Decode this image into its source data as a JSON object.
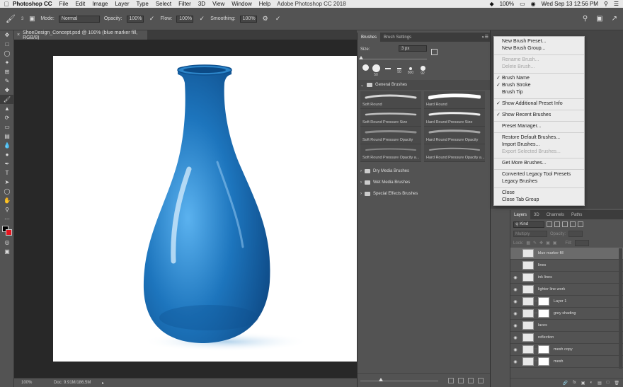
{
  "menubar": {
    "app": "Photoshop CC",
    "items": [
      "File",
      "Edit",
      "Image",
      "Layer",
      "Type",
      "Select",
      "Filter",
      "3D",
      "View",
      "Window",
      "Help"
    ],
    "window_title": "Adobe Photoshop CC 2018",
    "battery": "100%",
    "clock": "Wed Sep 13  12:56 PM"
  },
  "options": {
    "brush_size": "3",
    "mode_label": "Mode:",
    "mode_value": "Normal",
    "opacity_label": "Opacity:",
    "opacity_value": "100%",
    "flow_label": "Flow:",
    "flow_value": "100%",
    "smoothing_label": "Smoothing:",
    "smoothing_value": "100%"
  },
  "document": {
    "tab_title": "ShoeDesign_Concept.psd @ 100% (blue marker fill, RGB/8)",
    "zoom": "100%",
    "doc_size": "Doc: 9.91M/186.5M"
  },
  "brushes": {
    "tabs": [
      "Brushes",
      "Brush Settings"
    ],
    "size_label": "Size:",
    "size_value": "3 px",
    "presets": [
      "50",
      "",
      "50",
      "800",
      "92"
    ],
    "general_group": "General Brushes",
    "cells": [
      "Soft Round",
      "Hard Round",
      "Soft Round Pressure Size",
      "Hard Round Pressure Size",
      "Soft Round Pressure Opacity",
      "Hard Round Pressure Opacity",
      "Soft Round Pressure Opacity a...",
      "Hard Round Pressure Opacity a..."
    ],
    "groups": [
      "Dry Media Brushes",
      "Wet Media Brushes",
      "Special Effects Brushes"
    ]
  },
  "flyout": {
    "sections": [
      [
        {
          "label": "New Brush Preset...",
          "disabled": false,
          "checked": false
        },
        {
          "label": "New Brush Group...",
          "disabled": false,
          "checked": false
        }
      ],
      [
        {
          "label": "Rename Brush...",
          "disabled": true,
          "checked": false
        },
        {
          "label": "Delete Brush...",
          "disabled": true,
          "checked": false
        }
      ],
      [
        {
          "label": "Brush Name",
          "disabled": false,
          "checked": true
        },
        {
          "label": "Brush Stroke",
          "disabled": false,
          "checked": true
        },
        {
          "label": "Brush Tip",
          "disabled": false,
          "checked": false
        }
      ],
      [
        {
          "label": "Show Additional Preset Info",
          "disabled": false,
          "checked": true
        }
      ],
      [
        {
          "label": "Show Recent Brushes",
          "disabled": false,
          "checked": true
        }
      ],
      [
        {
          "label": "Preset Manager...",
          "disabled": false,
          "checked": false
        }
      ],
      [
        {
          "label": "Restore Default Brushes...",
          "disabled": false,
          "checked": false
        },
        {
          "label": "Import Brushes...",
          "disabled": false,
          "checked": false
        },
        {
          "label": "Export Selected Brushes...",
          "disabled": true,
          "checked": false
        }
      ],
      [
        {
          "label": "Get More Brushes...",
          "disabled": false,
          "checked": false
        }
      ],
      [
        {
          "label": "Converted Legacy Tool Presets",
          "disabled": false,
          "checked": false
        },
        {
          "label": "Legacy Brushes",
          "disabled": false,
          "checked": false
        }
      ],
      [
        {
          "label": "Close",
          "disabled": false,
          "checked": false
        },
        {
          "label": "Close Tab Group",
          "disabled": false,
          "checked": false
        }
      ]
    ]
  },
  "layers": {
    "tabs": [
      "Layers",
      "3D",
      "Channels",
      "Paths"
    ],
    "kind": "Kind",
    "blend": "Multiply",
    "opacity_label": "Opacity:",
    "lock_label": "Lock:",
    "fill_label": "Fill:",
    "rows": [
      {
        "name": "blue marker fill",
        "visible": false,
        "selected": true,
        "mask": false
      },
      {
        "name": "lines",
        "visible": false,
        "selected": false,
        "mask": false
      },
      {
        "name": "ink lines",
        "visible": true,
        "selected": false,
        "mask": false
      },
      {
        "name": "lighter line work",
        "visible": true,
        "selected": false,
        "mask": false
      },
      {
        "name": "Layer 1",
        "visible": true,
        "selected": false,
        "mask": true
      },
      {
        "name": "grey shading",
        "visible": true,
        "selected": false,
        "mask": true
      },
      {
        "name": "laces",
        "visible": true,
        "selected": false,
        "mask": false
      },
      {
        "name": "reflection",
        "visible": true,
        "selected": false,
        "mask": false
      },
      {
        "name": "mesh copy",
        "visible": true,
        "selected": false,
        "mask": true
      },
      {
        "name": "mesh",
        "visible": true,
        "selected": false,
        "mask": true
      }
    ],
    "footer_icons": [
      "link-icon",
      "fx-icon",
      "mask-icon",
      "adjustment-icon",
      "folder-icon",
      "new-layer-icon",
      "trash-icon"
    ]
  },
  "colors": {
    "foreground": "#000000",
    "background": "#e6141e",
    "vase": "#1a6fb4"
  }
}
